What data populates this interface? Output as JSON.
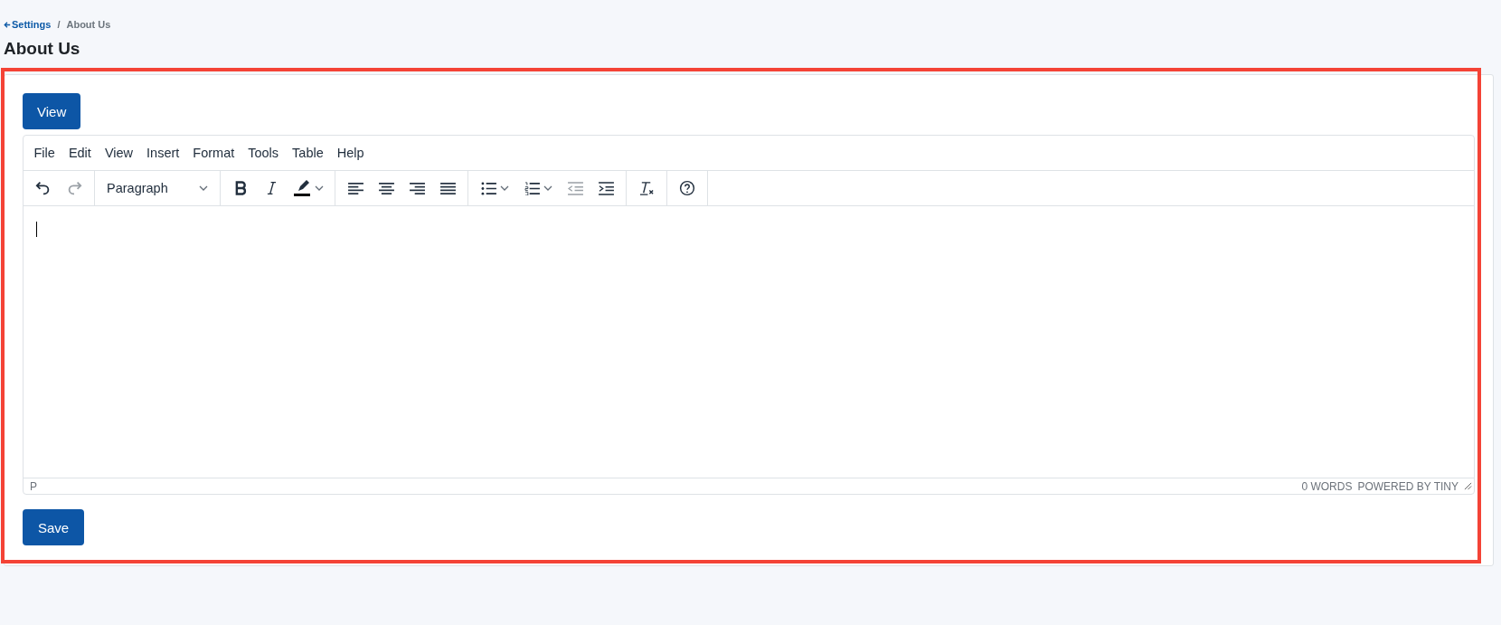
{
  "breadcrumb": {
    "back": "Settings",
    "separator": "/",
    "current": "About Us"
  },
  "title": "About Us",
  "view_button": "View",
  "editor": {
    "menu": [
      "File",
      "Edit",
      "View",
      "Insert",
      "Format",
      "Tools",
      "Table",
      "Help"
    ],
    "toolbar": [
      [
        {
          "kind": "undo",
          "disabled": false
        },
        {
          "kind": "redo",
          "disabled": true
        }
      ],
      [
        {
          "kind": "blocks",
          "label": "Paragraph",
          "disabled": false
        }
      ],
      [
        {
          "kind": "bold",
          "disabled": false
        },
        {
          "kind": "italic",
          "disabled": false
        },
        {
          "kind": "highlight",
          "disabled": false
        }
      ],
      [
        {
          "kind": "align-left",
          "disabled": false
        },
        {
          "kind": "align-center",
          "disabled": false
        },
        {
          "kind": "align-right",
          "disabled": false
        },
        {
          "kind": "justify",
          "disabled": false
        }
      ],
      [
        {
          "kind": "bullets",
          "disabled": false
        },
        {
          "kind": "numbers",
          "disabled": false
        },
        {
          "kind": "outdent",
          "disabled": true
        },
        {
          "kind": "indent",
          "disabled": false
        }
      ],
      [
        {
          "kind": "clear-format",
          "disabled": false
        }
      ],
      [
        {
          "kind": "help",
          "disabled": false
        }
      ]
    ],
    "path": "P",
    "word_count": "0 WORDS",
    "branding": "POWERED BY TINY"
  },
  "save_button": "Save",
  "highlight": {
    "color": "#f44336"
  }
}
